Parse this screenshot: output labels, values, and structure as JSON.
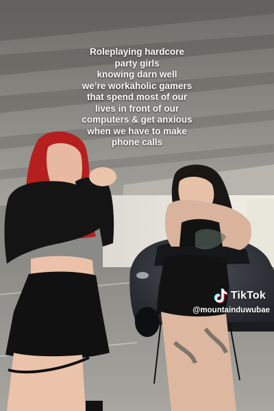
{
  "caption": {
    "lines": [
      "Roleplaying hardcore",
      "party girls",
      "knowing darn well",
      "we’re workaholic gamers",
      "that spend most of our",
      "lives in front of our",
      "computers & get anxious",
      "when we have to make",
      "phone calls"
    ]
  },
  "watermark": {
    "icon": "tiktok-logo-icon",
    "brand": "TikTok",
    "handle": "@mountainduwubae"
  },
  "colors": {
    "concrete": "#8e8d88",
    "hair_red": "#b5201e",
    "clothing": "#141414",
    "car": "#2b2e33"
  }
}
